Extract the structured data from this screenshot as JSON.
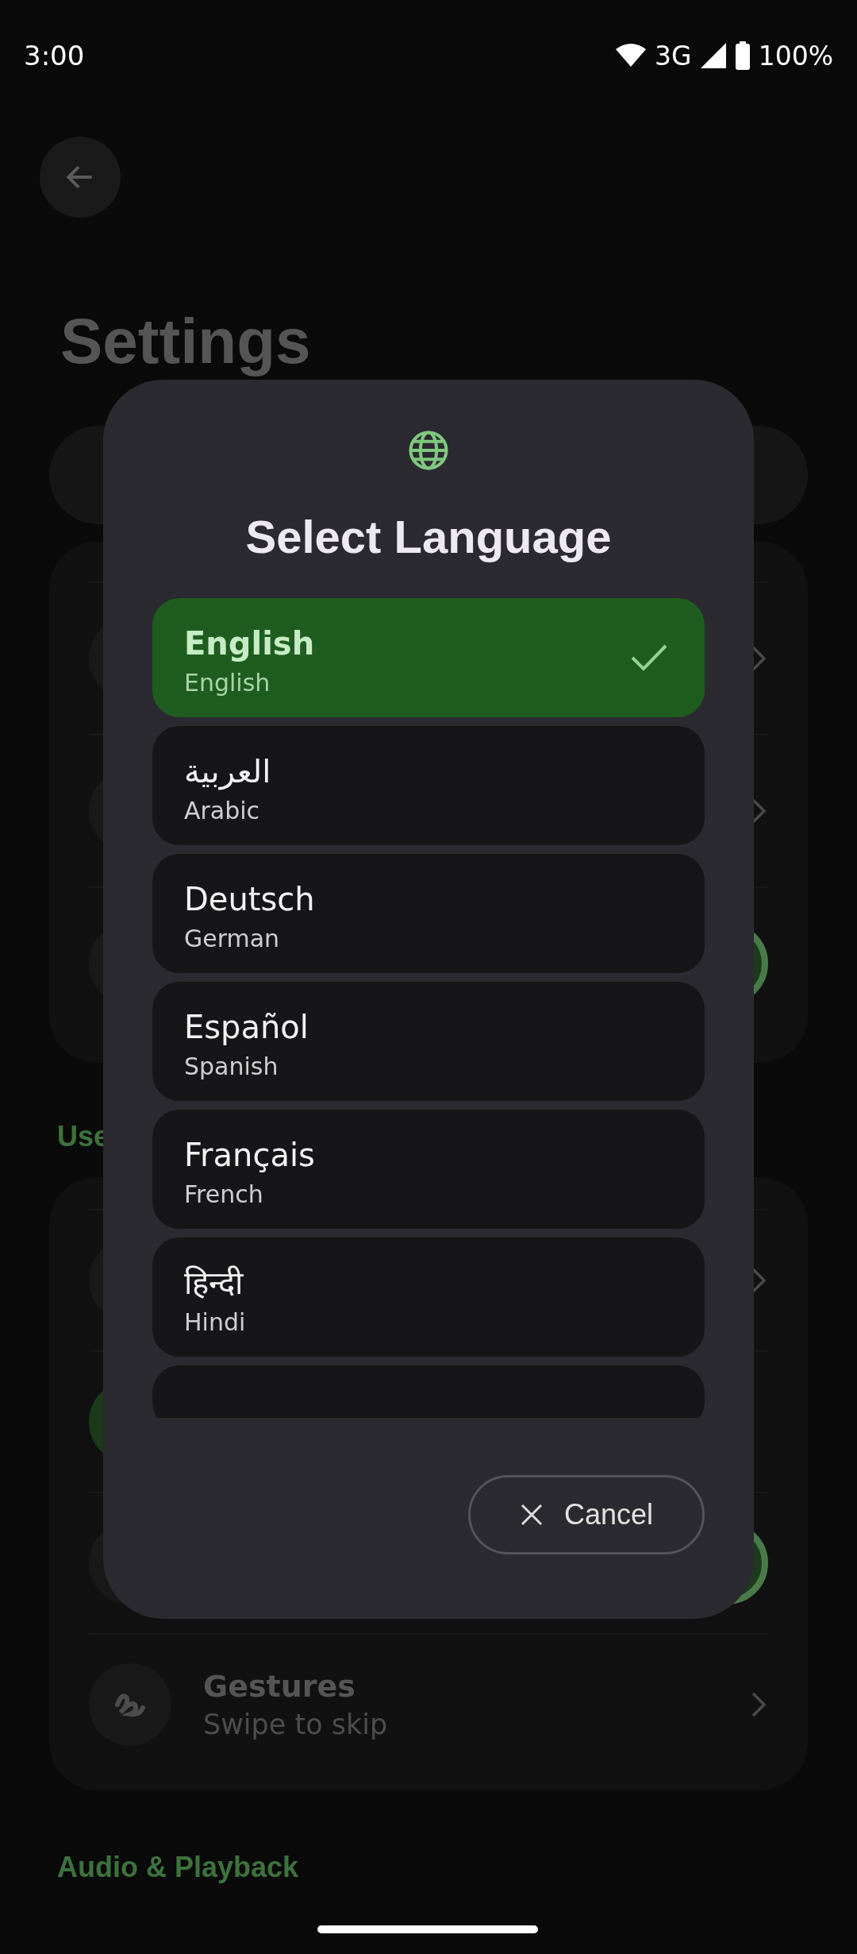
{
  "status_bar": {
    "time": "3:00",
    "network": "3G",
    "battery": "100%"
  },
  "settings": {
    "title": "Settings",
    "card_1": [
      {
        "kind": "chevron"
      },
      {
        "kind": "chevron"
      },
      {
        "kind": "toggle",
        "on": true
      }
    ],
    "section_1": "Use",
    "card_2": [
      {
        "kind": "chevron"
      },
      {
        "kind": "icon"
      },
      {
        "kind": "toggle",
        "on": true
      },
      {
        "kind": "chevron",
        "title": "Gestures",
        "subtitle": "Swipe to skip"
      }
    ],
    "section_2": "Audio & Playback"
  },
  "dialog": {
    "title": "Select Language",
    "languages": [
      {
        "name": "English",
        "english": "English",
        "selected": true
      },
      {
        "name": "العربية",
        "english": "Arabic",
        "selected": false
      },
      {
        "name": "Deutsch",
        "english": "German",
        "selected": false
      },
      {
        "name": "Español",
        "english": "Spanish",
        "selected": false
      },
      {
        "name": "Français",
        "english": "French",
        "selected": false
      },
      {
        "name": "हिन्दी",
        "english": "Hindi",
        "selected": false
      }
    ],
    "cancel": "Cancel"
  }
}
